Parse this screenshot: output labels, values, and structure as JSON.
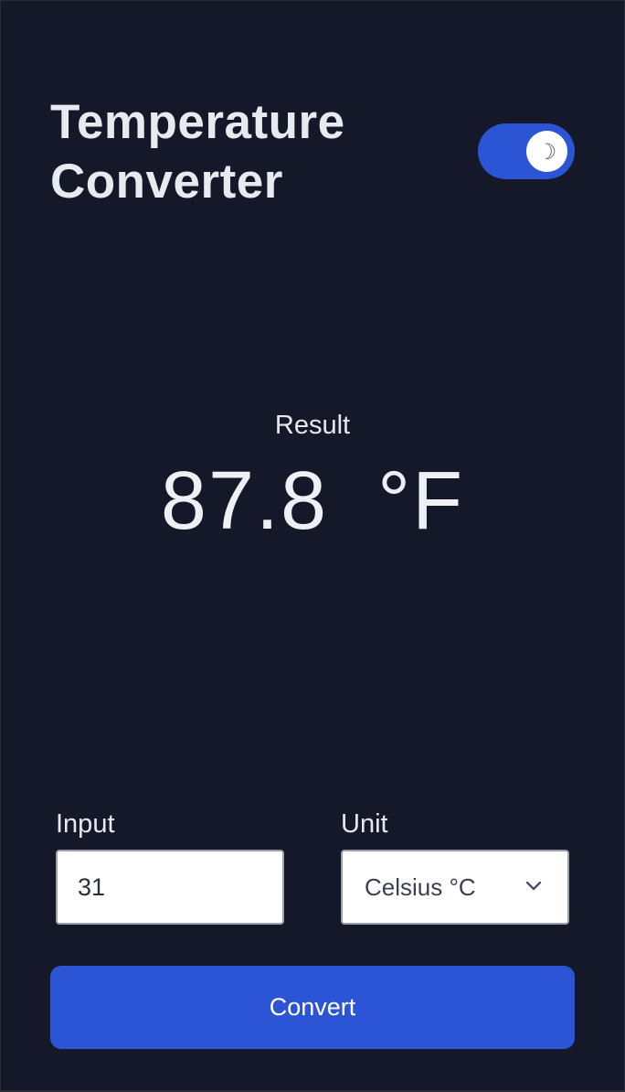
{
  "header": {
    "title_line1": "Temperature",
    "title_line2": "Converter",
    "theme_toggle": {
      "state": "dark",
      "icon": "moon-icon"
    }
  },
  "result": {
    "label": "Result",
    "value": "87.8",
    "unit": "°F"
  },
  "form": {
    "input_label": "Input",
    "input_value": "31",
    "unit_label": "Unit",
    "unit_value": "Celsius °C"
  },
  "actions": {
    "convert_label": "Convert"
  },
  "colors": {
    "background": "#141829",
    "accent": "#2c55d6",
    "text": "#e6e8ef"
  }
}
